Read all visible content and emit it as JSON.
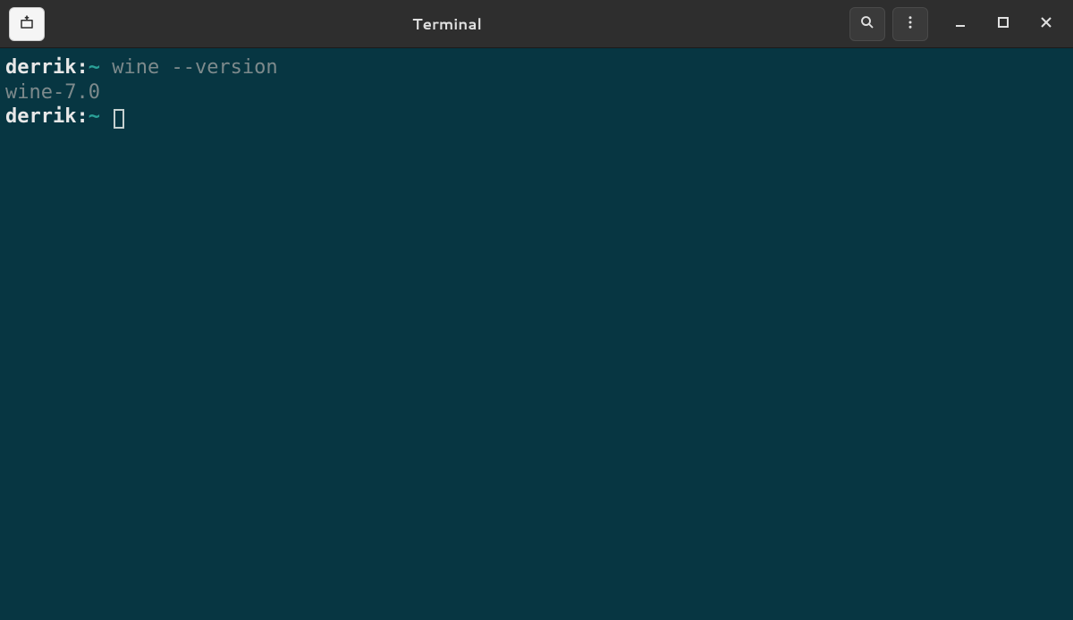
{
  "titlebar": {
    "title": "Terminal"
  },
  "terminal": {
    "lines": [
      {
        "user": "derrik",
        "colon": ":",
        "tilde": "~",
        "command": " wine --version"
      },
      {
        "output": "wine-7.0"
      },
      {
        "user": "derrik",
        "colon": ":",
        "tilde": "~",
        "command": " "
      }
    ]
  }
}
